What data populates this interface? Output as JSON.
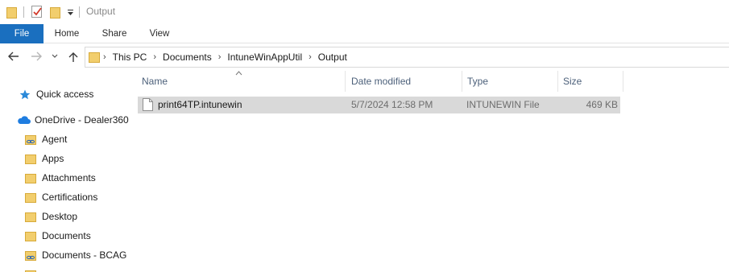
{
  "window": {
    "title": "Output"
  },
  "ribbon": {
    "tabs": [
      "File",
      "Home",
      "Share",
      "View"
    ]
  },
  "address": {
    "crumbs": [
      "This PC",
      "Documents",
      "IntuneWinAppUtil",
      "Output"
    ]
  },
  "nav": {
    "quick_access": "Quick access",
    "onedrive": "OneDrive - Dealer360",
    "folders": [
      "Agent",
      "Apps",
      "Attachments",
      "Certifications",
      "Desktop",
      "Documents",
      "Documents - BCAG"
    ]
  },
  "columns": {
    "name": "Name",
    "date": "Date modified",
    "type": "Type",
    "size": "Size"
  },
  "files": [
    {
      "name": "print64TP.intunewin",
      "date": "5/7/2024 12:58 PM",
      "type": "INTUNEWIN File",
      "size": "469 KB"
    }
  ],
  "colors": {
    "file_tab": "#1a6fbf",
    "selected_row": "#d9d9d9",
    "folder": "#f2ce6d",
    "onedrive": "#1f7de0"
  }
}
